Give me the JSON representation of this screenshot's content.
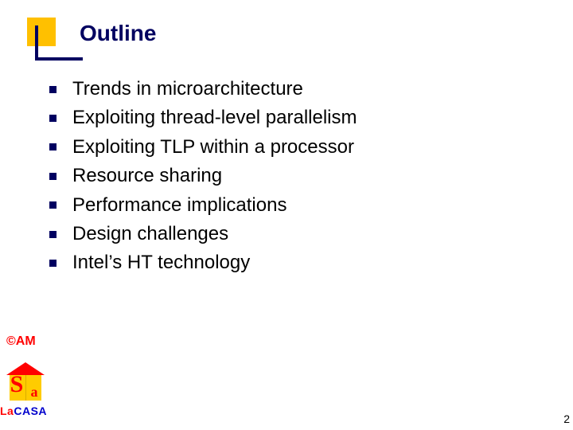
{
  "title": "Outline",
  "bullets": [
    "Trends in microarchitecture",
    "Exploiting thread-level parallelism",
    "Exploiting TLP within a processor",
    "Resource sharing",
    "Performance implications",
    "Design challenges",
    "Intel’s HT technology"
  ],
  "author_mark": "©AM",
  "footer_lab": {
    "la": "La",
    "casa": "CASA"
  },
  "page_number": "2"
}
